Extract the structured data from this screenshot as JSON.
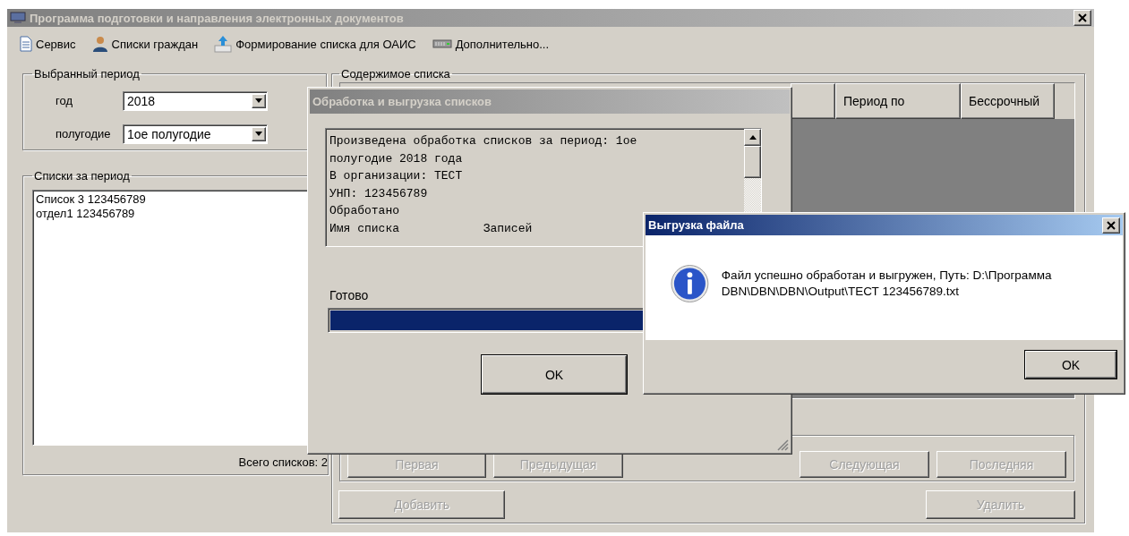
{
  "window": {
    "title": "Программа подготовки и направления электронных документов",
    "active": false
  },
  "menu": [
    {
      "label": "Сервис",
      "kind": "document"
    },
    {
      "label": "Списки граждан",
      "kind": "person"
    },
    {
      "label": "Формирование списка для ОАИС",
      "kind": "upload"
    },
    {
      "label": "Дополнительно...",
      "kind": "drive"
    }
  ],
  "period": {
    "title": "Выбранный период",
    "fields": [
      {
        "label": "год",
        "value": "2018"
      },
      {
        "label": "полугодие",
        "value": "1ое полугодие"
      }
    ]
  },
  "lists": {
    "title": "Списки за период",
    "items": [
      "Список 3 123456789",
      "отдел1 123456789"
    ],
    "total": "Всего списков: 2"
  },
  "contents": {
    "title": "Содержимое списка",
    "columns": [
      "Период по",
      "Бессрочный"
    ],
    "nav_buttons": [
      {
        "label": "Первая",
        "disabled": true
      },
      {
        "label": "Предыдущая",
        "disabled": true
      },
      {
        "label": "Следующая",
        "disabled": true
      },
      {
        "label": "Последняя",
        "disabled": true
      }
    ],
    "actions": [
      {
        "label": "Добавить",
        "disabled": true
      },
      {
        "label": "Удалить",
        "disabled": true
      }
    ]
  },
  "processing_dialog": {
    "title": "Обработка и выгрузка списков",
    "active": false,
    "log": [
      "Произведена обработка списков за период: 1ое",
      "полугодие 2018 года",
      "В организации: ТЕСТ",
      "УНП: 123456789",
      "Обработано",
      "Имя списка            Записей"
    ],
    "status": "Готово",
    "level": 1,
    "button": "OK"
  },
  "message_dialog": {
    "title": "Выгрузка файла",
    "active": true,
    "message": "Файл успешно обработан и выгружен, Путь: D:\\Программа DBN\\DBN\\DBN\\Output\\ТЕСТ 123456789.txt",
    "button": "OK"
  }
}
